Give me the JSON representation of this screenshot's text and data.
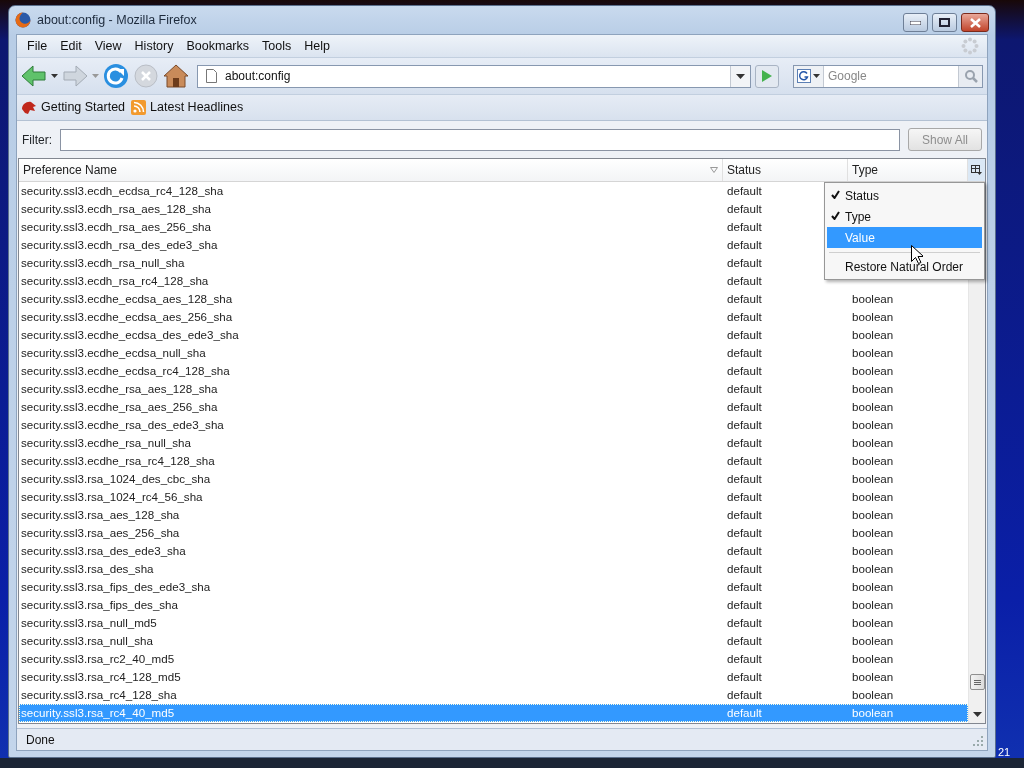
{
  "window": {
    "title": "about:config - Mozilla Firefox"
  },
  "menu_bar": [
    "File",
    "Edit",
    "View",
    "History",
    "Bookmarks",
    "Tools",
    "Help"
  ],
  "navigation": {
    "address": "about:config",
    "search_placeholder": "Google"
  },
  "bookmarks": [
    "Getting Started",
    "Latest Headlines"
  ],
  "filter": {
    "label": "Filter:",
    "button": "Show All",
    "button_disabled": true
  },
  "table": {
    "columns": [
      "Preference Name",
      "Status",
      "Type"
    ],
    "rows": [
      {
        "name": "security.ssl3.ecdh_ecdsa_rc4_128_sha",
        "status": "default",
        "selected": false
      },
      {
        "name": "security.ssl3.ecdh_rsa_aes_128_sha",
        "status": "default",
        "selected": false
      },
      {
        "name": "security.ssl3.ecdh_rsa_aes_256_sha",
        "status": "default",
        "selected": false
      },
      {
        "name": "security.ssl3.ecdh_rsa_des_ede3_sha",
        "status": "default",
        "selected": false
      },
      {
        "name": "security.ssl3.ecdh_rsa_null_sha",
        "status": "default",
        "selected": false
      },
      {
        "name": "security.ssl3.ecdh_rsa_rc4_128_sha",
        "status": "default",
        "selected": false
      },
      {
        "name": "security.ssl3.ecdhe_ecdsa_aes_128_sha",
        "status": "default",
        "type": "boolean",
        "selected": false
      },
      {
        "name": "security.ssl3.ecdhe_ecdsa_aes_256_sha",
        "status": "default",
        "type": "boolean",
        "selected": false
      },
      {
        "name": "security.ssl3.ecdhe_ecdsa_des_ede3_sha",
        "status": "default",
        "type": "boolean",
        "selected": false
      },
      {
        "name": "security.ssl3.ecdhe_ecdsa_null_sha",
        "status": "default",
        "type": "boolean",
        "selected": false
      },
      {
        "name": "security.ssl3.ecdhe_ecdsa_rc4_128_sha",
        "status": "default",
        "type": "boolean",
        "selected": false
      },
      {
        "name": "security.ssl3.ecdhe_rsa_aes_128_sha",
        "status": "default",
        "type": "boolean",
        "selected": false
      },
      {
        "name": "security.ssl3.ecdhe_rsa_aes_256_sha",
        "status": "default",
        "type": "boolean",
        "selected": false
      },
      {
        "name": "security.ssl3.ecdhe_rsa_des_ede3_sha",
        "status": "default",
        "type": "boolean",
        "selected": false
      },
      {
        "name": "security.ssl3.ecdhe_rsa_null_sha",
        "status": "default",
        "type": "boolean",
        "selected": false
      },
      {
        "name": "security.ssl3.ecdhe_rsa_rc4_128_sha",
        "status": "default",
        "type": "boolean",
        "selected": false
      },
      {
        "name": "security.ssl3.rsa_1024_des_cbc_sha",
        "status": "default",
        "type": "boolean",
        "selected": false
      },
      {
        "name": "security.ssl3.rsa_1024_rc4_56_sha",
        "status": "default",
        "type": "boolean",
        "selected": false
      },
      {
        "name": "security.ssl3.rsa_aes_128_sha",
        "status": "default",
        "type": "boolean",
        "selected": false
      },
      {
        "name": "security.ssl3.rsa_aes_256_sha",
        "status": "default",
        "type": "boolean",
        "selected": false
      },
      {
        "name": "security.ssl3.rsa_des_ede3_sha",
        "status": "default",
        "type": "boolean",
        "selected": false
      },
      {
        "name": "security.ssl3.rsa_des_sha",
        "status": "default",
        "type": "boolean",
        "selected": false
      },
      {
        "name": "security.ssl3.rsa_fips_des_ede3_sha",
        "status": "default",
        "type": "boolean",
        "selected": false
      },
      {
        "name": "security.ssl3.rsa_fips_des_sha",
        "status": "default",
        "type": "boolean",
        "selected": false
      },
      {
        "name": "security.ssl3.rsa_null_md5",
        "status": "default",
        "type": "boolean",
        "selected": false
      },
      {
        "name": "security.ssl3.rsa_null_sha",
        "status": "default",
        "type": "boolean",
        "selected": false
      },
      {
        "name": "security.ssl3.rsa_rc2_40_md5",
        "status": "default",
        "type": "boolean",
        "selected": false
      },
      {
        "name": "security.ssl3.rsa_rc4_128_md5",
        "status": "default",
        "type": "boolean",
        "selected": false
      },
      {
        "name": "security.ssl3.rsa_rc4_128_sha",
        "status": "default",
        "type": "boolean",
        "selected": false
      },
      {
        "name": "security.ssl3.rsa_rc4_40_md5",
        "status": "default",
        "type": "boolean",
        "selected": true
      }
    ]
  },
  "column_menu": [
    {
      "label": "Status",
      "checked": true,
      "selected": false
    },
    {
      "label": "Type",
      "checked": true,
      "selected": false
    },
    {
      "label": "Value",
      "checked": false,
      "selected": true
    },
    {
      "label": "Restore Natural Order",
      "kind": "command",
      "selected": false
    }
  ],
  "status_bar": "Done",
  "taskbar": {
    "clock": "21"
  }
}
